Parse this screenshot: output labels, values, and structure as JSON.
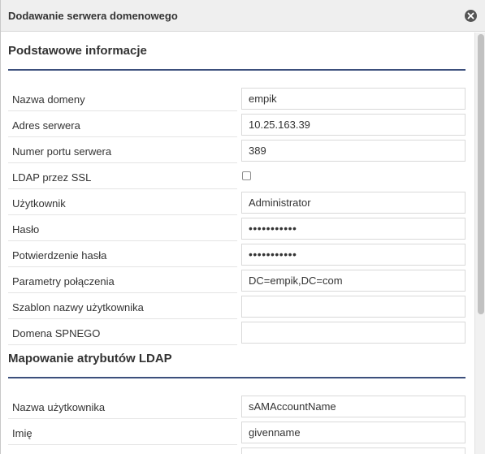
{
  "dialog": {
    "title": "Dodawanie serwera domenowego",
    "close_icon": "close-circle-icon"
  },
  "basic_section": {
    "title": "Podstawowe informacje",
    "rows": [
      {
        "label": "Nazwa domeny",
        "value": "empik"
      },
      {
        "label": "Adres serwera",
        "value": "10.25.163.39"
      },
      {
        "label": "Numer portu serwera",
        "value": "389"
      },
      {
        "label": "LDAP przez SSL",
        "checked": false
      },
      {
        "label": "Użytkownik",
        "value": "Administrator"
      },
      {
        "label": "Hasło",
        "value": "•••••••••••"
      },
      {
        "label": "Potwierdzenie hasła",
        "value": "•••••••••••"
      },
      {
        "label": "Parametry połączenia",
        "value": "DC=empik,DC=com"
      },
      {
        "label": "Szablon nazwy użytkownika",
        "value": ""
      },
      {
        "label": "Domena SPNEGO",
        "value": ""
      }
    ]
  },
  "ldap_section": {
    "title": "Mapowanie atrybutów LDAP",
    "rows": [
      {
        "label": "Nazwa użytkownika",
        "value": "sAMAccountName"
      },
      {
        "label": "Imię",
        "value": "givenname"
      }
    ]
  },
  "colors": {
    "section_rule": "#3c4f7c",
    "titlebar_bg": "#efefef"
  }
}
